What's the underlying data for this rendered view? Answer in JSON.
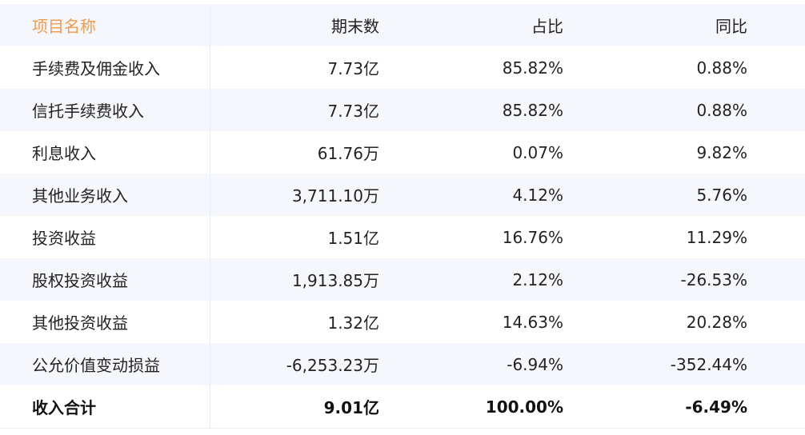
{
  "header": {
    "name": "项目名称",
    "end": "期末数",
    "ratio": "占比",
    "yoy": "同比"
  },
  "rows": [
    {
      "name": "手续费及佣金收入",
      "end": "7.73亿",
      "ratio": "85.82%",
      "yoy": "0.88%"
    },
    {
      "name": "信托手续费收入",
      "end": "7.73亿",
      "ratio": "85.82%",
      "yoy": "0.88%"
    },
    {
      "name": "利息收入",
      "end": "61.76万",
      "ratio": "0.07%",
      "yoy": "9.82%"
    },
    {
      "name": "其他业务收入",
      "end": "3,711.10万",
      "ratio": "4.12%",
      "yoy": "5.76%"
    },
    {
      "name": "投资收益",
      "end": "1.51亿",
      "ratio": "16.76%",
      "yoy": "11.29%"
    },
    {
      "name": "股权投资收益",
      "end": "1,913.85万",
      "ratio": "2.12%",
      "yoy": "-26.53%"
    },
    {
      "name": "其他投资收益",
      "end": "1.32亿",
      "ratio": "14.63%",
      "yoy": "20.28%"
    },
    {
      "name": "公允价值变动损益",
      "end": "-6,253.23万",
      "ratio": "-6.94%",
      "yoy": "-352.44%"
    }
  ],
  "total": {
    "name": "收入合计",
    "end": "9.01亿",
    "ratio": "100.00%",
    "yoy": "-6.49%"
  },
  "colors": {
    "header_name": "#f29b4b",
    "stripe": "#f5f7fc",
    "text": "#222222"
  }
}
